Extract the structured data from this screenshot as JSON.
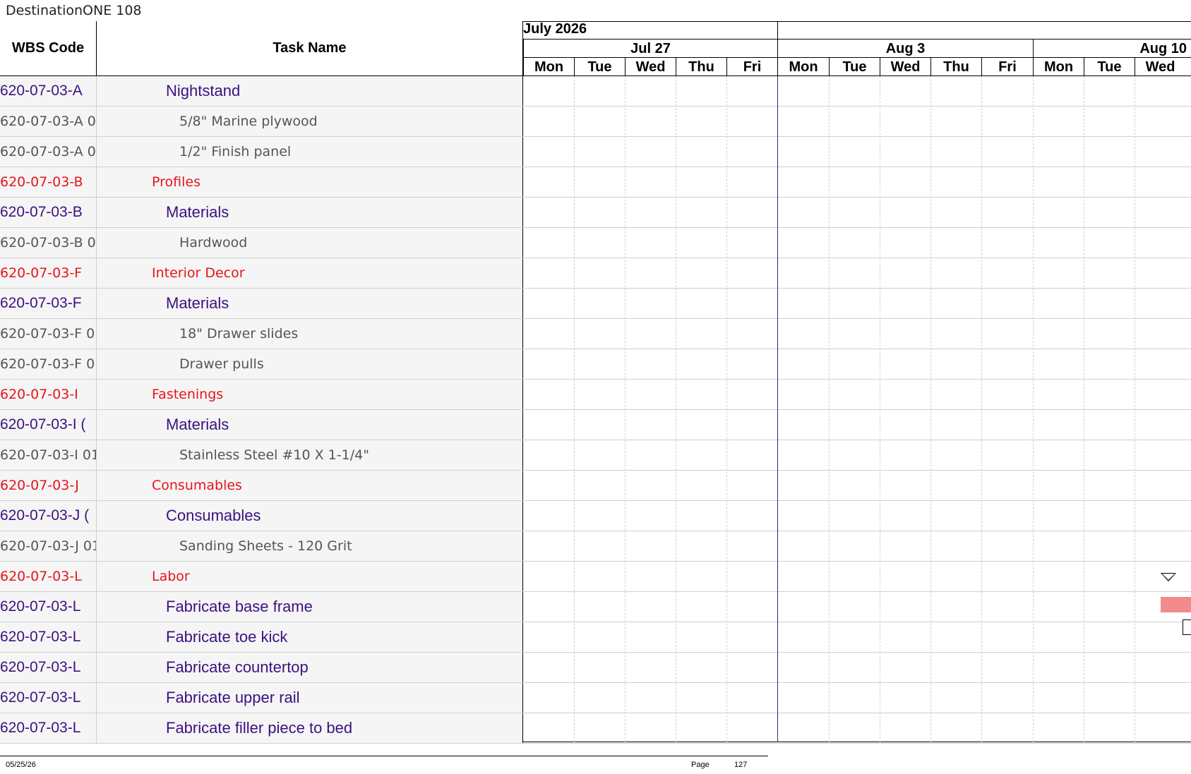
{
  "document": {
    "title": "DestinationONE 108"
  },
  "columns": {
    "wbs": "WBS Code",
    "task": "Task Name"
  },
  "timeline": {
    "month": "July 2026",
    "weeks": [
      "Jul 27",
      "Aug 3",
      "Aug 10"
    ],
    "days": [
      "Mon",
      "Tue",
      "Wed",
      "Thu",
      "Fri",
      "Mon",
      "Tue",
      "Wed",
      "Thu",
      "Fri",
      "Mon",
      "Tue",
      "Wed"
    ]
  },
  "rows": [
    {
      "wbs": "620-07-03-A",
      "task": "Nightstand",
      "level": "purple"
    },
    {
      "wbs": "620-07-03-A 0",
      "task": "5/8\" Marine plywood",
      "level": "gray"
    },
    {
      "wbs": "620-07-03-A 0",
      "task": "1/2\" Finish panel",
      "level": "gray"
    },
    {
      "wbs": "620-07-03-B",
      "task": "Profiles",
      "level": "red"
    },
    {
      "wbs": "620-07-03-B",
      "task": "Materials",
      "level": "purple"
    },
    {
      "wbs": "620-07-03-B 0",
      "task": "Hardwood",
      "level": "gray"
    },
    {
      "wbs": "620-07-03-F",
      "task": "Interior Decor",
      "level": "red"
    },
    {
      "wbs": "620-07-03-F",
      "task": "Materials",
      "level": "purple"
    },
    {
      "wbs": "620-07-03-F 0",
      "task": "18\" Drawer slides",
      "level": "gray"
    },
    {
      "wbs": "620-07-03-F 0",
      "task": "Drawer pulls",
      "level": "gray"
    },
    {
      "wbs": "620-07-03-I",
      "task": "Fastenings",
      "level": "red"
    },
    {
      "wbs": "620-07-03-I (",
      "task": "Materials",
      "level": "purple"
    },
    {
      "wbs": "620-07-03-I 01",
      "task": "Stainless Steel #10 X 1-1/4\"",
      "level": "gray"
    },
    {
      "wbs": "620-07-03-J",
      "task": "Consumables",
      "level": "red"
    },
    {
      "wbs": "620-07-03-J (",
      "task": "Consumables",
      "level": "purple"
    },
    {
      "wbs": "620-07-03-J 01",
      "task": "Sanding Sheets - 120 Grit",
      "level": "gray"
    },
    {
      "wbs": "620-07-03-L",
      "task": "Labor",
      "level": "red"
    },
    {
      "wbs": "620-07-03-L",
      "task": "Fabricate base frame",
      "level": "purple"
    },
    {
      "wbs": "620-07-03-L",
      "task": "Fabricate toe kick",
      "level": "purple"
    },
    {
      "wbs": "620-07-03-L",
      "task": "Fabricate countertop",
      "level": "purple"
    },
    {
      "wbs": "620-07-03-L",
      "task": "Fabricate upper rail",
      "level": "purple"
    },
    {
      "wbs": "620-07-03-L",
      "task": "Fabricate filler piece to bed",
      "level": "purple"
    }
  ],
  "footer": {
    "date": "05/25/26",
    "page_label": "Page",
    "page_number": "127"
  },
  "colors": {
    "summary": "#e8141b",
    "group": "#3b1180",
    "detail": "#555555",
    "bar": "#f28b8b",
    "week_line": "#2a2a8a"
  }
}
